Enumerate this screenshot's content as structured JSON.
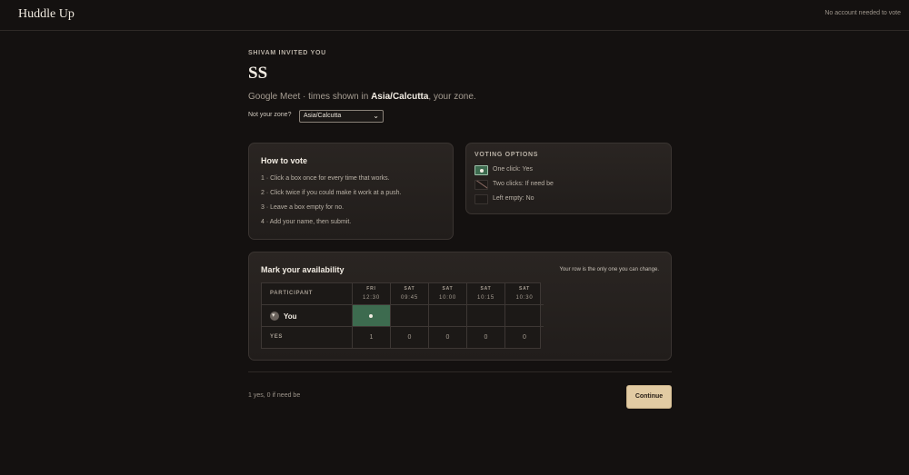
{
  "app": {
    "brand": "Huddle Up",
    "top_note": "No account needed to vote"
  },
  "event": {
    "invited_by": "SHIVAM INVITED YOU",
    "title": "SS",
    "subtitle_prefix": "Google Meet · times shown in ",
    "zone": "Asia/Calcutta",
    "subtitle_suffix": ", your zone."
  },
  "zone_picker": {
    "label": "Not your zone?",
    "selected": "Asia/Calcutta"
  },
  "how_to": {
    "title": "How to vote",
    "steps": [
      "1 · Click a box once for every time that works.",
      "2 · Click twice if you could make it work at a push.",
      "3 · Leave a box empty for no.",
      "4 · Add your name, then submit."
    ]
  },
  "voting_options": {
    "title": "VOTING OPTIONS",
    "items": [
      {
        "label": "One click: Yes",
        "icon": "yes-swatch-icon"
      },
      {
        "label": "Two clicks: If need be",
        "icon": "if-need-be-swatch-icon"
      },
      {
        "label": "Left empty: No",
        "icon": "empty-swatch-icon"
      }
    ]
  },
  "availability": {
    "title": "Mark your availability",
    "note": "Your row is the only one you can change.",
    "participant_header": "PARTICIPANT",
    "columns": [
      {
        "day": "FRI",
        "time": "12:30"
      },
      {
        "day": "SAT",
        "time": "09:45"
      },
      {
        "day": "SAT",
        "time": "10:00"
      },
      {
        "day": "SAT",
        "time": "10:15"
      },
      {
        "day": "SAT",
        "time": "10:30"
      }
    ],
    "you_label": "You",
    "you_votes": [
      "yes",
      "no",
      "no",
      "no",
      "no"
    ],
    "totals_label": "YES",
    "totals": [
      "1",
      "0",
      "0",
      "0",
      "0"
    ]
  },
  "footer": {
    "summary": "1 yes, 0 if need be",
    "continue_label": "Continue"
  },
  "colors": {
    "background": "#141110",
    "yes": "#3d6b4f",
    "accent_button": "#e2cba3"
  }
}
